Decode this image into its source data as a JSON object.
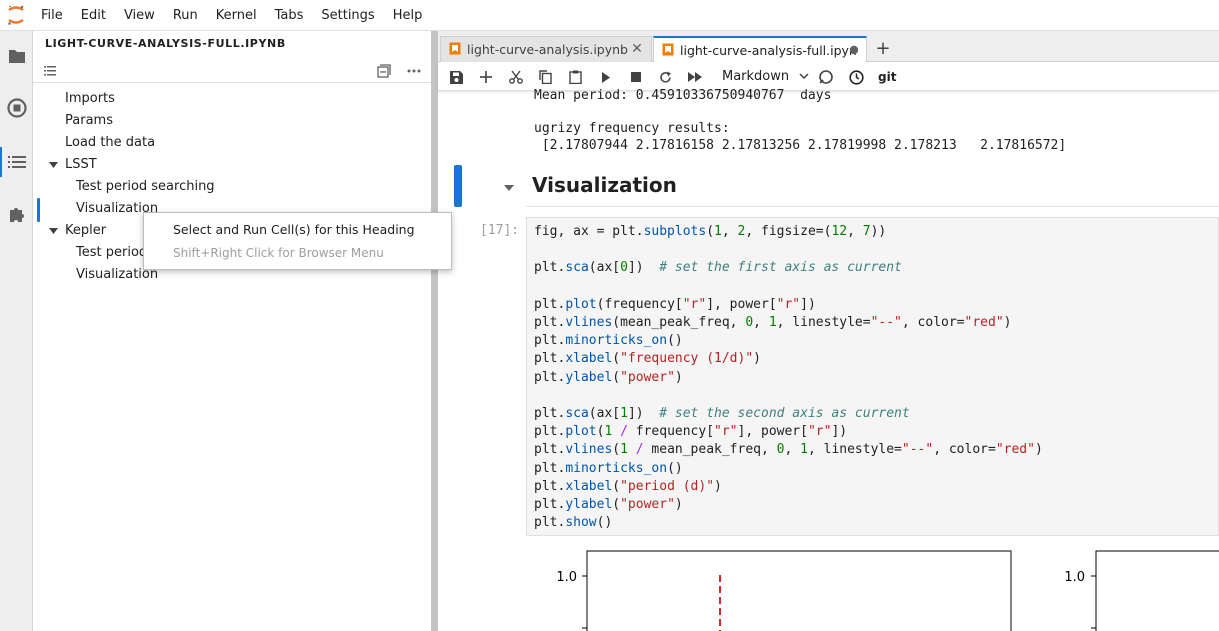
{
  "menubar": {
    "items": [
      "File",
      "Edit",
      "View",
      "Run",
      "Kernel",
      "Tabs",
      "Settings",
      "Help"
    ]
  },
  "activitybar": {
    "icons": [
      "folder-icon",
      "stop-circle-icon",
      "list-icon",
      "puzzle-icon"
    ]
  },
  "toc": {
    "title": "LIGHT-CURVE-ANALYSIS-FULL.IPYNB",
    "items": [
      {
        "label": "Imports"
      },
      {
        "label": "Params"
      },
      {
        "label": "Load the data"
      },
      {
        "label": "LSST"
      },
      {
        "label": "Test period searching"
      },
      {
        "label": "Visualization"
      },
      {
        "label": "Kepler"
      },
      {
        "label": "Test period"
      },
      {
        "label": "Visualization"
      }
    ]
  },
  "context_menu": {
    "run_label": "Select and Run Cell(s) for this Heading",
    "hint_label": "Shift+Right Click for Browser Menu"
  },
  "tabs": [
    {
      "label": "light-curve-analysis.ipynb",
      "active": false
    },
    {
      "label": "light-curve-analysis-full.ipyn",
      "active": true
    }
  ],
  "toolbar": {
    "cell_type": "Markdown",
    "git_label": "git"
  },
  "output": {
    "lines": [
      "Mean period: 0.45910336750940767  days",
      "",
      "ugrizy frequency results:",
      " [2.17807944 2.17816158 2.17813256 2.17819998 2.178213   2.17816572]"
    ]
  },
  "heading": {
    "text": "Visualization"
  },
  "cell": {
    "prompt": "[17]:",
    "lines": [
      [
        [
          "fig, ax = plt.",
          ""
        ],
        [
          "subplots",
          "f"
        ],
        [
          "(",
          ""
        ],
        [
          "1",
          "n"
        ],
        [
          ", ",
          ""
        ],
        [
          "2",
          "n"
        ],
        [
          ", figsize=(",
          ""
        ],
        [
          "12",
          "n"
        ],
        [
          ", ",
          ""
        ],
        [
          "7",
          "n"
        ],
        [
          "))",
          ""
        ]
      ],
      [],
      [
        [
          "plt.",
          ""
        ],
        [
          "sca",
          "f"
        ],
        [
          "(ax[",
          ""
        ],
        [
          "0",
          "n"
        ],
        [
          "])  ",
          ""
        ],
        [
          "# set the first axis as current",
          "c"
        ]
      ],
      [],
      [
        [
          "plt.",
          ""
        ],
        [
          "plot",
          "f"
        ],
        [
          "(frequency[",
          ""
        ],
        [
          "\"r\"",
          "s"
        ],
        [
          "], power[",
          ""
        ],
        [
          "\"r\"",
          "s"
        ],
        [
          "])",
          ""
        ]
      ],
      [
        [
          "plt.",
          ""
        ],
        [
          "vlines",
          "f"
        ],
        [
          "(mean_peak_freq, ",
          ""
        ],
        [
          "0",
          "n"
        ],
        [
          ", ",
          ""
        ],
        [
          "1",
          "n"
        ],
        [
          ", linestyle=",
          ""
        ],
        [
          "\"--\"",
          "s"
        ],
        [
          ", color=",
          ""
        ],
        [
          "\"red\"",
          "s"
        ],
        [
          ")",
          ""
        ]
      ],
      [
        [
          "plt.",
          ""
        ],
        [
          "minorticks_on",
          "f"
        ],
        [
          "()",
          ""
        ]
      ],
      [
        [
          "plt.",
          ""
        ],
        [
          "xlabel",
          "f"
        ],
        [
          "(",
          ""
        ],
        [
          "\"frequency (1/d)\"",
          "s"
        ],
        [
          ")",
          ""
        ]
      ],
      [
        [
          "plt.",
          ""
        ],
        [
          "ylabel",
          "f"
        ],
        [
          "(",
          ""
        ],
        [
          "\"power\"",
          "s"
        ],
        [
          ")",
          ""
        ]
      ],
      [],
      [
        [
          "plt.",
          ""
        ],
        [
          "sca",
          "f"
        ],
        [
          "(ax[",
          ""
        ],
        [
          "1",
          "n"
        ],
        [
          "])  ",
          ""
        ],
        [
          "# set the second axis as current",
          "c"
        ]
      ],
      [
        [
          "plt.",
          ""
        ],
        [
          "plot",
          "f"
        ],
        [
          "(",
          ""
        ],
        [
          "1",
          "n"
        ],
        [
          " ",
          ""
        ],
        [
          "/",
          "o"
        ],
        [
          " frequency[",
          ""
        ],
        [
          "\"r\"",
          "s"
        ],
        [
          "], power[",
          ""
        ],
        [
          "\"r\"",
          "s"
        ],
        [
          "])",
          ""
        ]
      ],
      [
        [
          "plt.",
          ""
        ],
        [
          "vlines",
          "f"
        ],
        [
          "(",
          ""
        ],
        [
          "1",
          "n"
        ],
        [
          " ",
          ""
        ],
        [
          "/",
          "o"
        ],
        [
          " mean_peak_freq, ",
          ""
        ],
        [
          "0",
          "n"
        ],
        [
          ", ",
          ""
        ],
        [
          "1",
          "n"
        ],
        [
          ", linestyle=",
          ""
        ],
        [
          "\"--\"",
          "s"
        ],
        [
          ", color=",
          ""
        ],
        [
          "\"red\"",
          "s"
        ],
        [
          ")",
          ""
        ]
      ],
      [
        [
          "plt.",
          ""
        ],
        [
          "minorticks_on",
          "f"
        ],
        [
          "()",
          ""
        ]
      ],
      [
        [
          "plt.",
          ""
        ],
        [
          "xlabel",
          "f"
        ],
        [
          "(",
          ""
        ],
        [
          "\"period (d)\"",
          "s"
        ],
        [
          ")",
          ""
        ]
      ],
      [
        [
          "plt.",
          ""
        ],
        [
          "ylabel",
          "f"
        ],
        [
          "(",
          ""
        ],
        [
          "\"power\"",
          "s"
        ],
        [
          ")",
          ""
        ]
      ],
      [
        [
          "plt.",
          ""
        ],
        [
          "show",
          "f"
        ],
        [
          "()",
          ""
        ]
      ]
    ]
  },
  "plots": {
    "left_ytick": "1.0",
    "right_ytick": "1.0",
    "vline_color": "#d62728"
  },
  "colors": {
    "accent": "#1976d2",
    "logo": "#f37626"
  }
}
